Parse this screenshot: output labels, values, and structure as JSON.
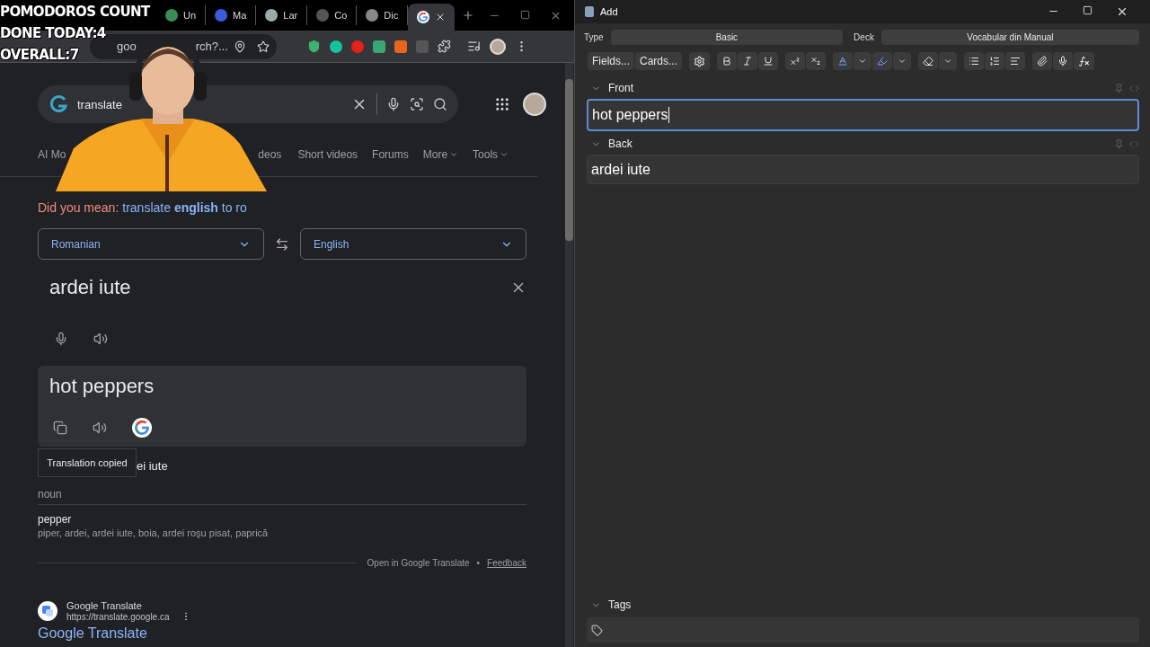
{
  "stream_overlay": {
    "lines": [
      "POMODOROS COUNT",
      "DONE TODAY:4",
      "OVERALL:7"
    ]
  },
  "browser": {
    "tabs": [
      {
        "label": "Un",
        "selected": false
      },
      {
        "label": "Ma",
        "selected": false
      },
      {
        "label": "Lar",
        "selected": false
      },
      {
        "label": "Co",
        "selected": false
      },
      {
        "label": "Dic",
        "selected": false
      },
      {
        "selected": true
      }
    ],
    "address": {
      "visible_parts": [
        "goo",
        "rch?..."
      ]
    },
    "search": {
      "query_visible": "translate"
    },
    "search_tabs": [
      {
        "label": "AI Mo",
        "dropdown": false
      },
      {
        "label": "deos",
        "dropdown": false
      },
      {
        "label": "Short videos",
        "dropdown": false
      },
      {
        "label": "Forums",
        "dropdown": false
      },
      {
        "label": "More",
        "dropdown": true
      },
      {
        "label": "Tools",
        "dropdown": true
      }
    ],
    "did_you_mean": {
      "prefix": "Did you mean:",
      "suggestion": "translate **english** to ro"
    },
    "translate": {
      "source_language": "Romanian",
      "target_language": "English",
      "source_text": "ardei iute",
      "translation": "hot peppers",
      "tooltip": "Translation copied",
      "heading_visible": "ei iute",
      "dictionary": {
        "part_of_speech": "noun",
        "entries": [
          {
            "word": "pepper",
            "translations": "piper, ardei, ardei iute, boia, ardei roşu pisat, paprică"
          }
        ]
      },
      "footer": {
        "open_link": "Open in Google Translate",
        "separator": "•",
        "feedback": "Feedback"
      }
    },
    "result": {
      "site": "Google Translate",
      "url": "https://translate.google.ca",
      "title": "Google Translate"
    }
  },
  "anki": {
    "title": "Add",
    "type_label": "Type",
    "type": "Basic",
    "deck_label": "Deck",
    "deck": "Vocabular din Manual",
    "buttons": [
      "Fields...",
      "Cards..."
    ],
    "fields": [
      {
        "name": "Front",
        "value": "hot peppers",
        "focused": true
      },
      {
        "name": "Back",
        "value": "ardei iute",
        "focused": false
      }
    ],
    "tags_label": "Tags"
  }
}
